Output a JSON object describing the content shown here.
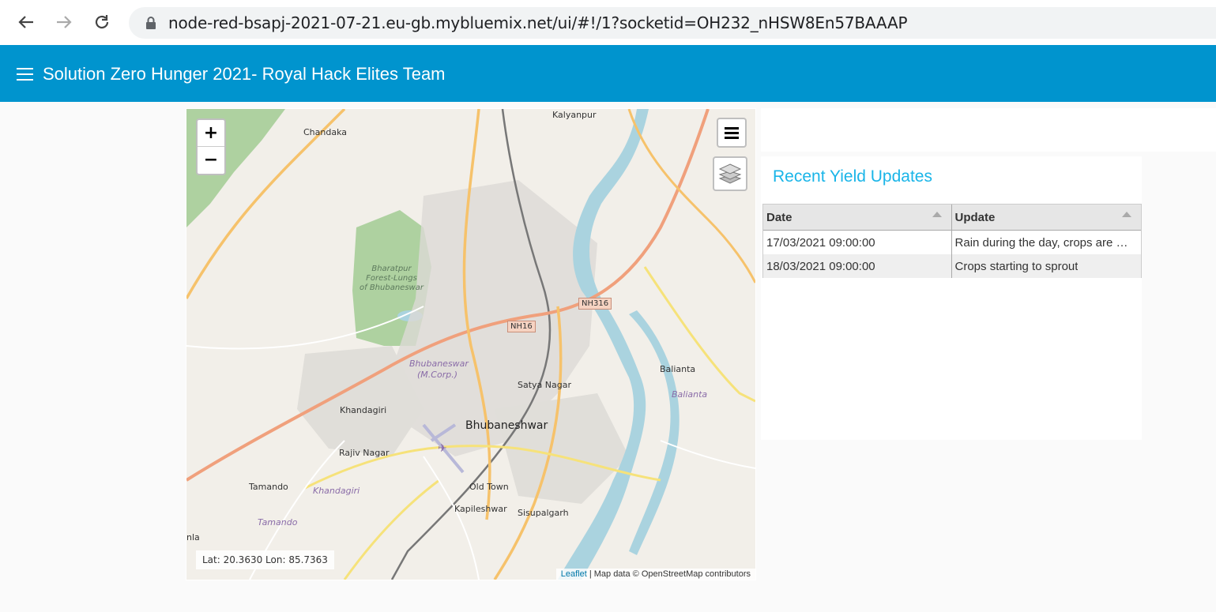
{
  "browser": {
    "url": "node-red-bsapj-2021-07-21.eu-gb.mybluemix.net/ui/#!/1?socketid=OH232_nHSW8En57BAAAP"
  },
  "app": {
    "title": "Solution Zero Hunger 2021- Royal Hack Elites Team",
    "bar_color": "#0094ce"
  },
  "map": {
    "zoom_in": "+",
    "zoom_out": "−",
    "coords": "Lat: 20.3630  Lon: 85.7363",
    "attribution_link": "Leaflet",
    "attribution_text": " | Map data © OpenStreetMap contributors",
    "labels": {
      "chandaka": "Chandaka",
      "kalyanpur": "Kalyanpur",
      "bharatpur_1": "Bharatpur",
      "bharatpur_2": "Forest-Lungs",
      "bharatpur_3": "of Bhubaneswar",
      "nh16": "NH16",
      "nh316": "NH316",
      "bbsr_corp_1": "Bhubaneswar",
      "bbsr_corp_2": "(M.Corp.)",
      "satya_nagar": "Satya Nagar",
      "balianta": "Balianta",
      "balianta_it": "Balianta",
      "khandagiri": "Khandagiri",
      "bhubaneshwar": "Bhubaneshwar",
      "rajiv_nagar": "Rajiv Nagar",
      "tamando": "Tamando",
      "khandagiri_it": "Khandagiri",
      "old_town": "Old Town",
      "kapileshwar": "Kapileshwar",
      "sisupalgarh": "Sisupalgarh",
      "tamando_it": "Tamando",
      "nla": "nla"
    }
  },
  "yield": {
    "title": "Recent Yield Updates",
    "title_color": "#1ab5e8",
    "columns": [
      "Date",
      "Update"
    ],
    "rows": [
      [
        "17/03/2021 09:00:00",
        "Rain during the day, crops are …"
      ],
      [
        "18/03/2021 09:00:00",
        "Crops starting to sprout"
      ]
    ]
  }
}
